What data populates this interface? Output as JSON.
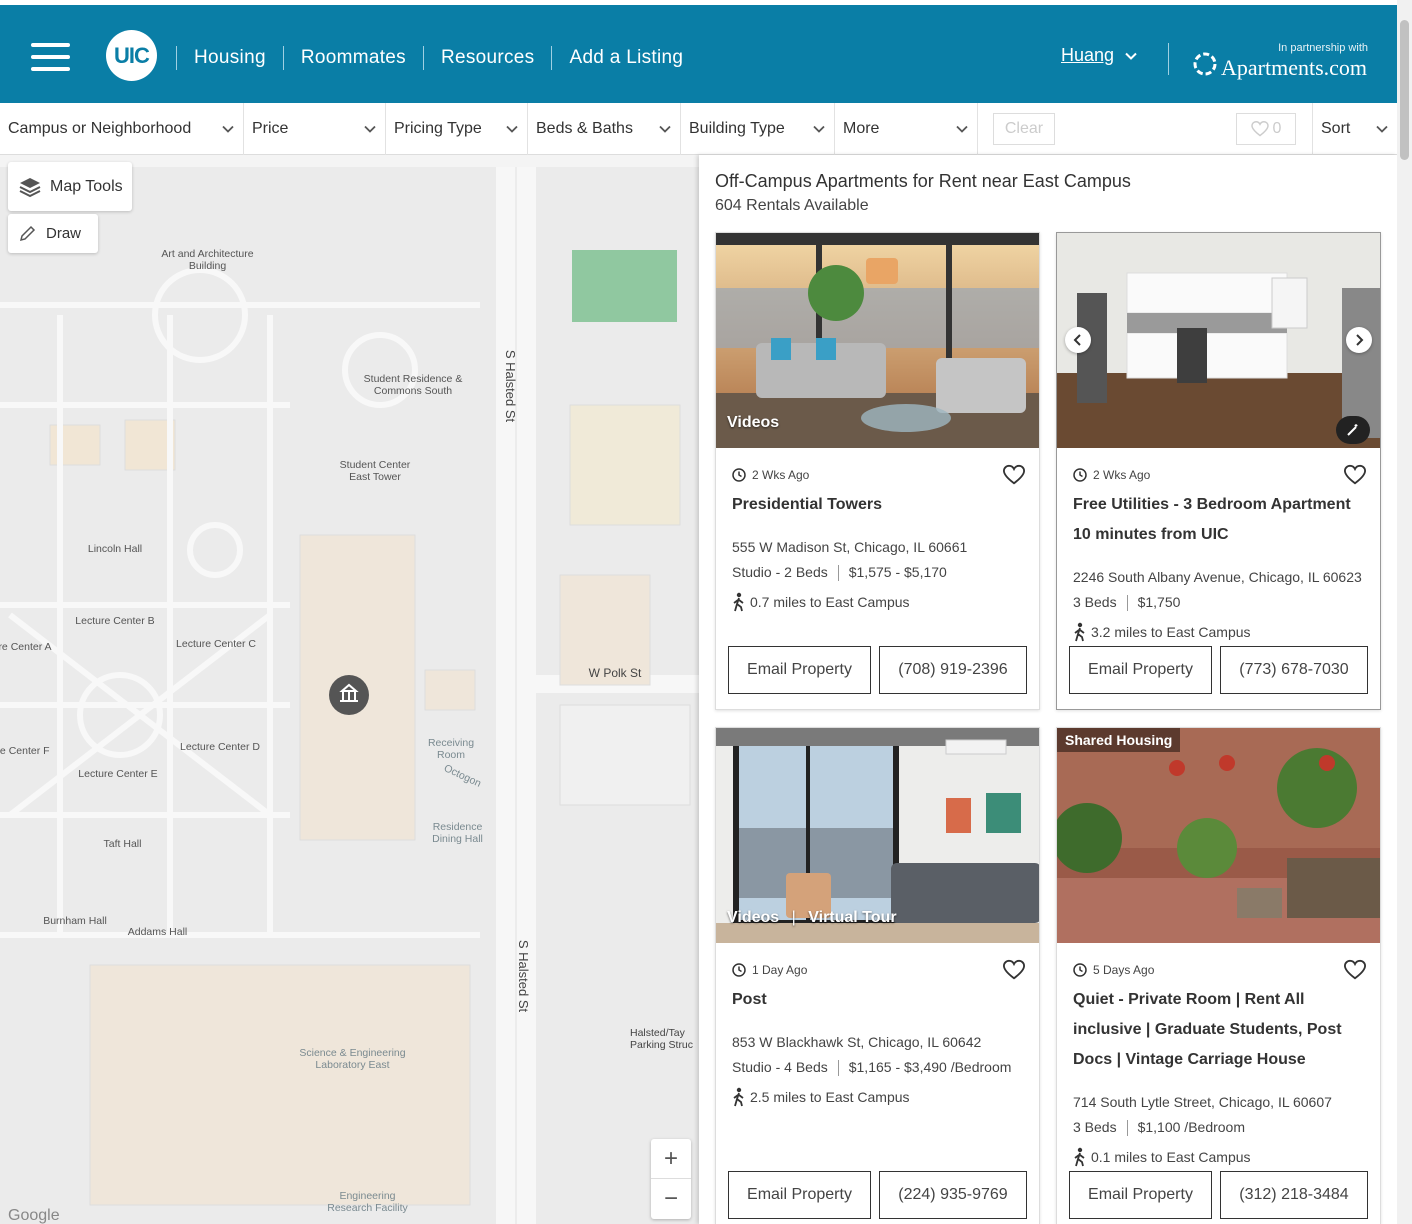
{
  "header": {
    "logo": "UIC",
    "nav": [
      "Housing",
      "Roommates",
      "Resources",
      "Add a Listing"
    ],
    "user": "Huang",
    "partner_small": "In partnership with",
    "partner_big": "Apartments.com"
  },
  "filters": {
    "items": [
      "Campus or Neighborhood",
      "Price",
      "Pricing Type",
      "Beds & Baths",
      "Building Type",
      "More"
    ],
    "clear": "Clear",
    "favorites_count": "0",
    "sort": "Sort"
  },
  "map": {
    "tools_label": "Map Tools",
    "draw_label": "Draw",
    "zoom_in": "+",
    "zoom_out": "−",
    "labels": {
      "art": "Art and Architecture Building",
      "srcs": "Student Residence & Commons South",
      "sce": "Student Center East Tower",
      "halsted1": "S Halsted St",
      "halsted2": "S Halsted St",
      "lincoln": "Lincoln Hall",
      "lcb": "Lecture Center B",
      "lca": "re Center A",
      "lcc": "Lecture Center C",
      "polk": "W Polk St",
      "lcf": "re Center F",
      "lcd": "Lecture Center D",
      "lce": "Lecture Center E",
      "receiving": "Receiving Room",
      "octogon": "Octogon",
      "rdh": "Residence Dining Hall",
      "taft": "Taft Hall",
      "burnham": "Burnham Hall",
      "addams": "Addams Hall",
      "sele": "Science & Engineering Laboratory East",
      "halsted_parking": "Halsted/Tay Parking Struc",
      "erf": "Engineering Research Facility",
      "google": "Google"
    }
  },
  "listing": {
    "title": "Off-Campus Apartments for Rent near East Campus",
    "count": "604 Rentals Available",
    "cards": [
      {
        "tag": "Videos",
        "ago": "2 Wks Ago",
        "name": "Presidential Towers",
        "address": "555 W Madison St, Chicago, IL 60661",
        "beds": "Studio - 2 Beds",
        "price": "$1,575 - $5,170",
        "distance": "0.7 miles to East Campus",
        "email": "Email Property",
        "phone": "(708) 919-2396"
      },
      {
        "tag": "",
        "ago": "2 Wks Ago",
        "name": "Free Utilities - 3 Bedroom Apartment 10 minutes from UIC",
        "address": "2246 South Albany Avenue, Chicago, IL 60623",
        "beds": "3 Beds",
        "price": "$1,750",
        "distance": "3.2 miles to East Campus",
        "email": "Email Property",
        "phone": "(773) 678-7030"
      },
      {
        "tag": "Videos",
        "tag2": "Virtual Tour",
        "ago": "1 Day Ago",
        "name": "Post",
        "address": "853 W Blackhawk St, Chicago, IL 60642",
        "beds": "Studio - 4 Beds",
        "price": "$1,165 - $3,490 /Bedroom",
        "distance": "2.5 miles to East Campus",
        "email": "Email Property",
        "phone": "(224) 935-9769"
      },
      {
        "toptag": "Shared Housing",
        "ago": "5 Days Ago",
        "name": "Quiet - Private Room | Rent All inclusive | Graduate Students, Post Docs | Vintage Carriage House",
        "address": "714 South Lytle Street, Chicago, IL 60607",
        "beds": "3 Beds",
        "price": "$1,100 /Bedroom",
        "distance": "0.1 miles to East Campus",
        "email": "Email Property",
        "phone": "(312) 218-3484"
      }
    ]
  }
}
